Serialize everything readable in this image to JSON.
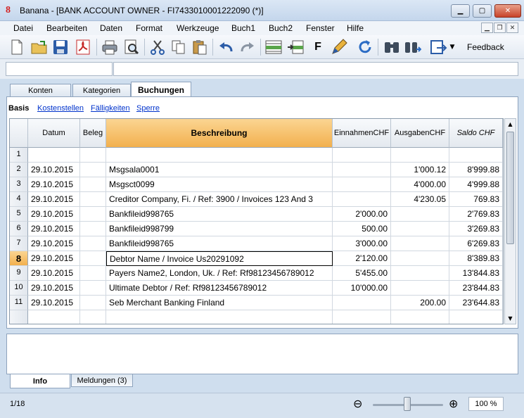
{
  "window": {
    "title": "Banana - [BANK ACCOUNT OWNER - FI7433010001222090 (*)]"
  },
  "menu": [
    "Datei",
    "Bearbeiten",
    "Daten",
    "Format",
    "Werkzeuge",
    "Buch1",
    "Buch2",
    "Fenster",
    "Hilfe"
  ],
  "toolbar": {
    "icons": [
      "new-file-icon",
      "open-folder-icon",
      "save-icon",
      "pdf-icon",
      "print-icon",
      "print-preview-icon",
      "cut-icon",
      "copy-icon",
      "paste-icon",
      "undo-icon",
      "redo-icon",
      "insert-row-icon",
      "move-row-icon",
      "format-icon",
      "edit-icon",
      "refresh-icon",
      "find-icon",
      "find-next-icon",
      "export-icon"
    ],
    "format_label": "F",
    "feedback_label": "Feedback"
  },
  "tabs": [
    "Konten",
    "Kategorien",
    "Buchungen"
  ],
  "views": [
    "Basis",
    "Kostenstellen",
    "Fälligkeiten",
    "Sperre"
  ],
  "table": {
    "columns": [
      "Datum",
      "Beleg",
      "Beschreibung",
      "EinnahmenCHF",
      "AusgabenCHF",
      "Saldo CHF"
    ],
    "rows": [
      {
        "n": "1",
        "date": "",
        "doc": "",
        "desc": "",
        "in": "",
        "out": "",
        "bal": ""
      },
      {
        "n": "2",
        "date": "29.10.2015",
        "doc": "",
        "desc": "Msgsala0001",
        "in": "",
        "out": "1'000.12",
        "bal": "8'999.88"
      },
      {
        "n": "3",
        "date": "29.10.2015",
        "doc": "",
        "desc": "Msgsct0099",
        "in": "",
        "out": "4'000.00",
        "bal": "4'999.88"
      },
      {
        "n": "4",
        "date": "29.10.2015",
        "doc": "",
        "desc": "Creditor Company, Fi.  / Ref: 3900 /  Invoices 123 And 3",
        "in": "",
        "out": "4'230.05",
        "bal": "769.83"
      },
      {
        "n": "5",
        "date": "29.10.2015",
        "doc": "",
        "desc": "Bankfileid998765",
        "in": "2'000.00",
        "out": "",
        "bal": "2'769.83"
      },
      {
        "n": "6",
        "date": "29.10.2015",
        "doc": "",
        "desc": "Bankfileid998799",
        "in": "500.00",
        "out": "",
        "bal": "3'269.83"
      },
      {
        "n": "7",
        "date": "29.10.2015",
        "doc": "",
        "desc": "Bankfileid998765",
        "in": "3'000.00",
        "out": "",
        "bal": "6'269.83"
      },
      {
        "n": "8",
        "date": "29.10.2015",
        "doc": "",
        "desc": "Debtor Name /  Invoice Us20291092",
        "in": "2'120.00",
        "out": "",
        "bal": "8'389.83"
      },
      {
        "n": "9",
        "date": "29.10.2015",
        "doc": "",
        "desc": "Payers Name2, London, Uk.  / Ref: Rf98123456789012",
        "in": "5'455.00",
        "out": "",
        "bal": "13'844.83"
      },
      {
        "n": "10",
        "date": "29.10.2015",
        "doc": "",
        "desc": "Ultimate Debtor / Ref: Rf98123456789012",
        "in": "10'000.00",
        "out": "",
        "bal": "23'844.83"
      },
      {
        "n": "11",
        "date": "29.10.2015",
        "doc": "",
        "desc": "Seb Merchant Banking Finland",
        "in": "",
        "out": "200.00",
        "bal": "23'644.83"
      },
      {
        "n": "",
        "date": "",
        "doc": "",
        "desc": "",
        "in": "",
        "out": "",
        "bal": ""
      }
    ]
  },
  "bottom_tabs": [
    "Info",
    "Meldungen (3)"
  ],
  "status": {
    "position": "1/18",
    "zoom": "100 %"
  }
}
